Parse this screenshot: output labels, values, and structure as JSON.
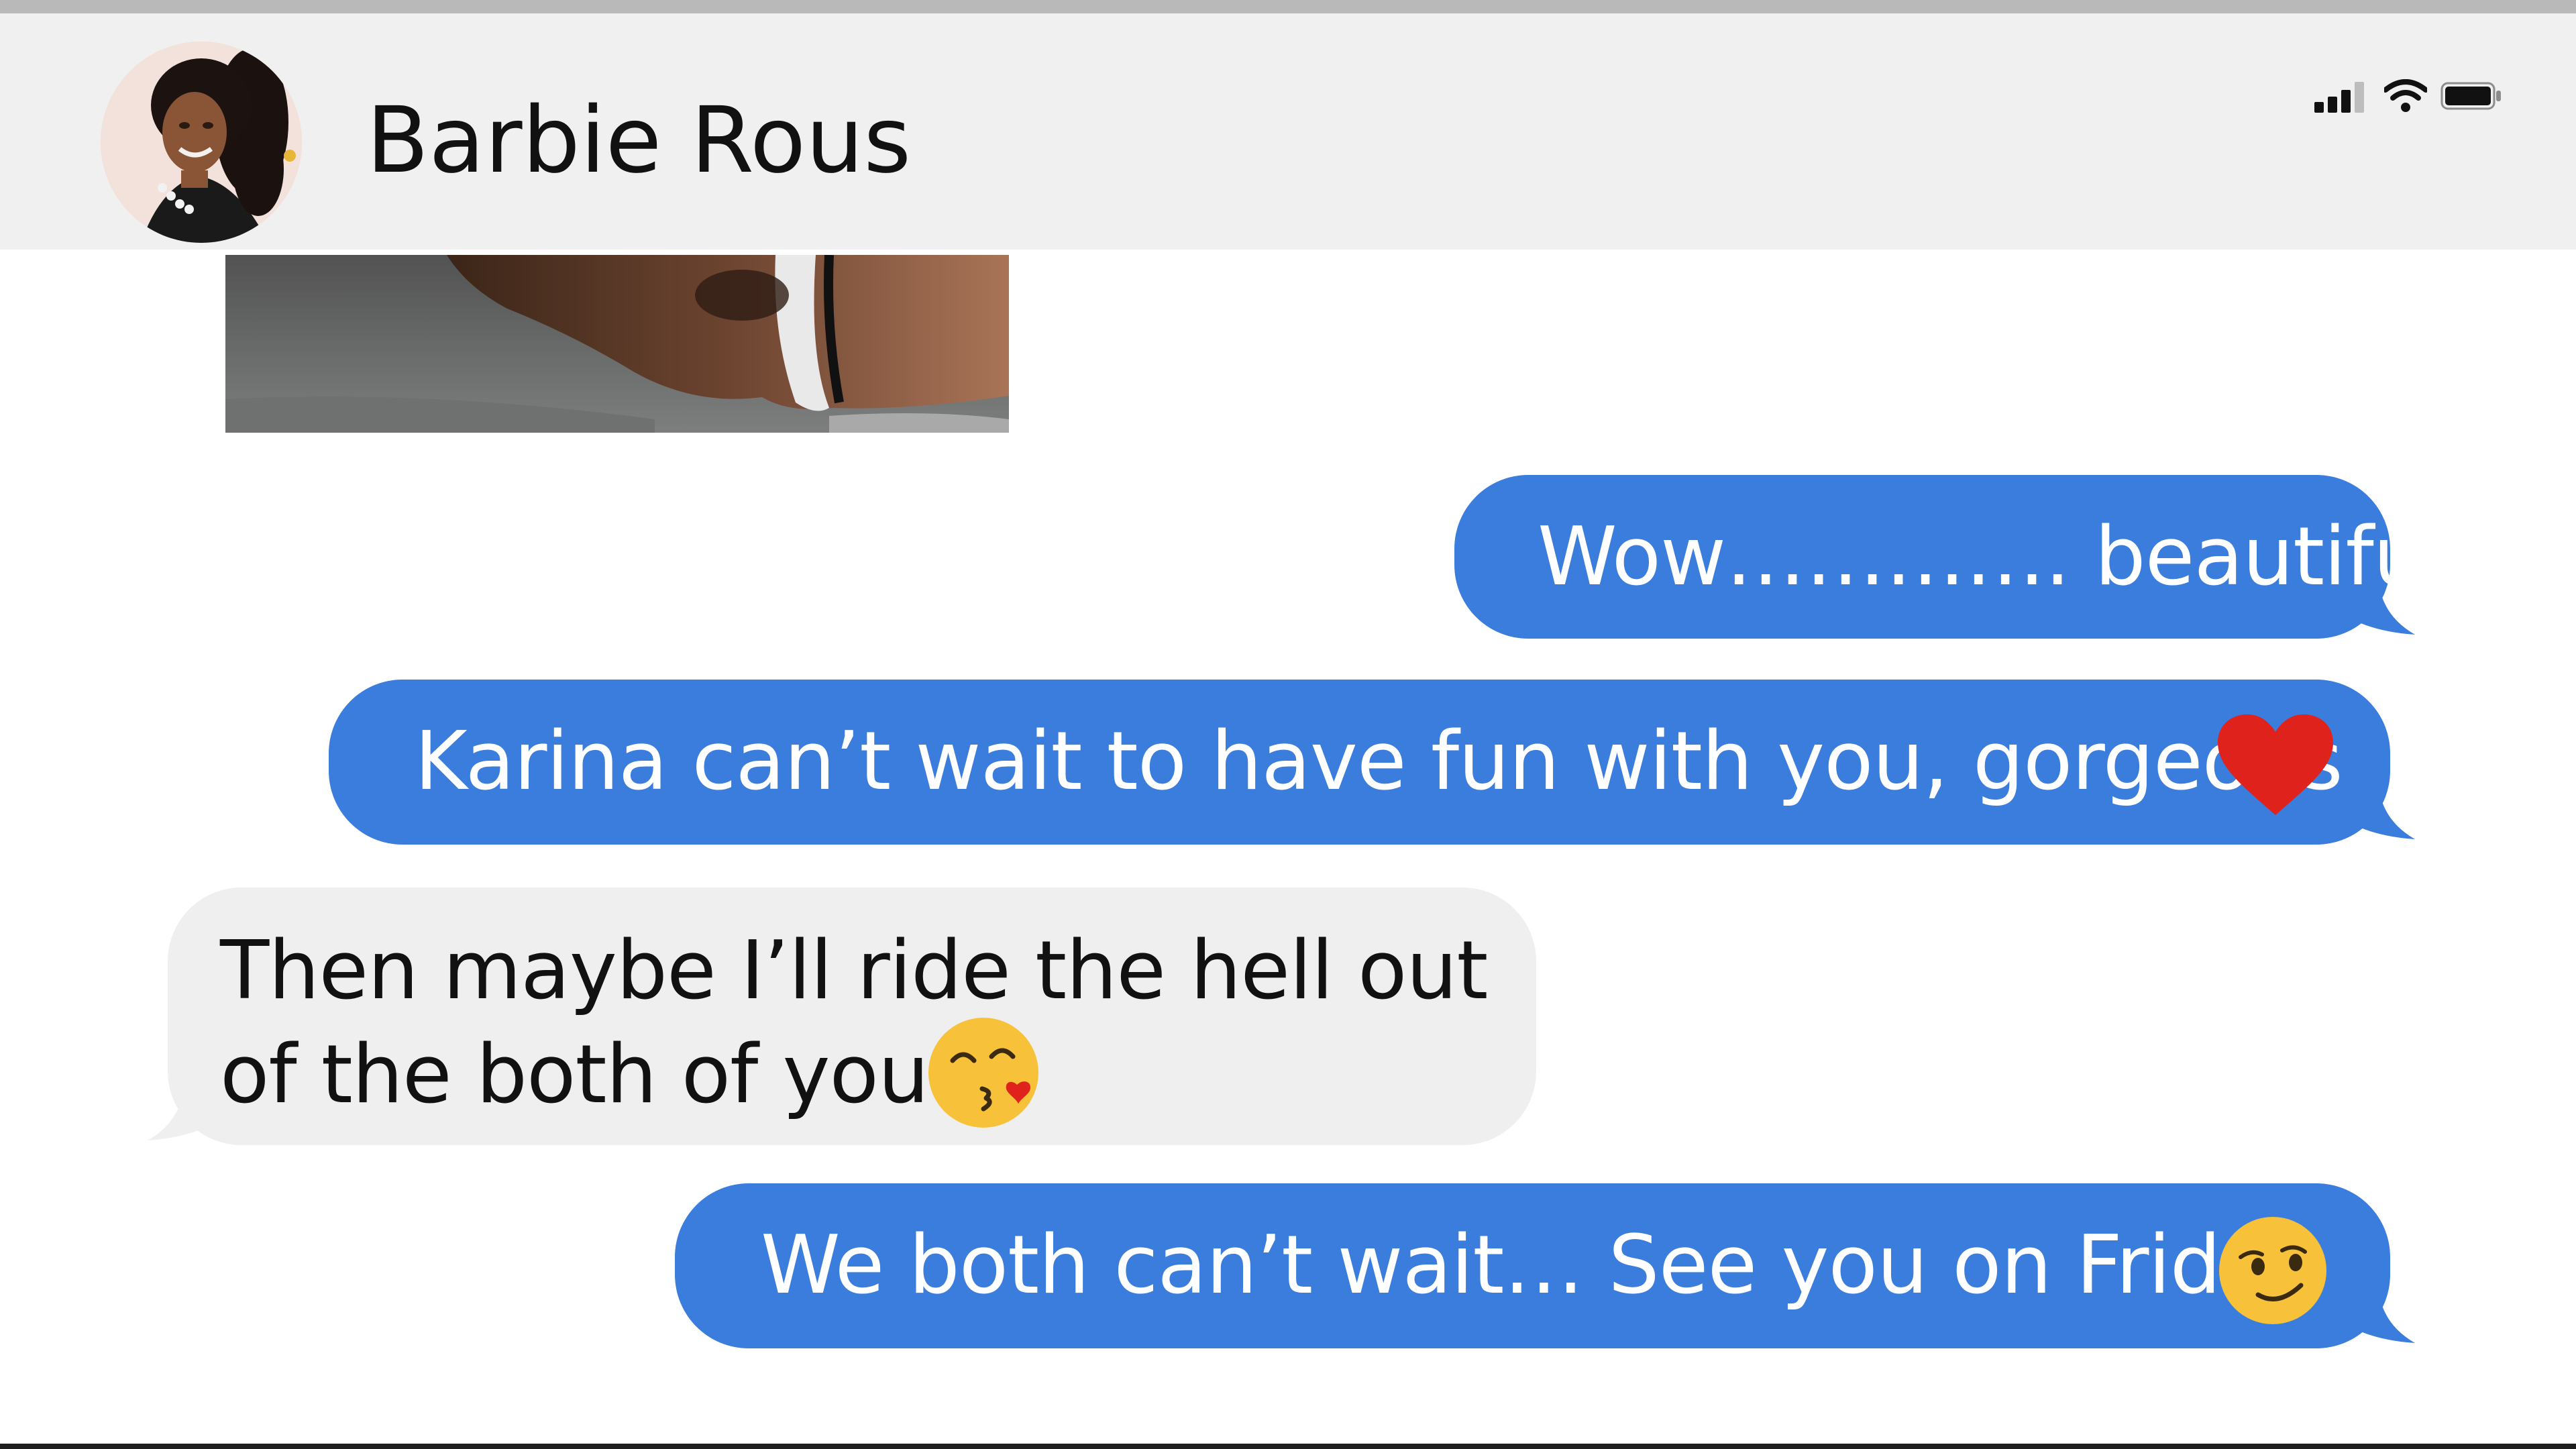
{
  "header": {
    "contact_name": "Barbie Rous",
    "avatar_icon": "contact-avatar-photo",
    "status_icons": [
      "signal-bars-icon",
      "wifi-icon",
      "battery-icon"
    ]
  },
  "thread": {
    "photo_message_icon": "photo-thumbnail",
    "messages": [
      {
        "direction": "outgoing",
        "text": "Wow…………. beautiful"
      },
      {
        "direction": "outgoing",
        "text": "Karina can’t wait to have fun with you, gorgeous",
        "emoji": "red-heart-icon"
      },
      {
        "direction": "incoming",
        "lines": [
          "Then maybe I’ll ride the hell out",
          "of the both of you"
        ],
        "emoji": "face-blowing-kiss-icon"
      },
      {
        "direction": "outgoing",
        "text": "We both can’t wait… See you on Friday",
        "emoji": "smirking-face-icon"
      }
    ]
  },
  "colors": {
    "outgoing_bubble": "#3b7ddc",
    "incoming_bubble": "#efefef",
    "header_background": "#f0f0f0",
    "heart": "#e0221c",
    "emoji_yellow": "#f7c13a"
  }
}
